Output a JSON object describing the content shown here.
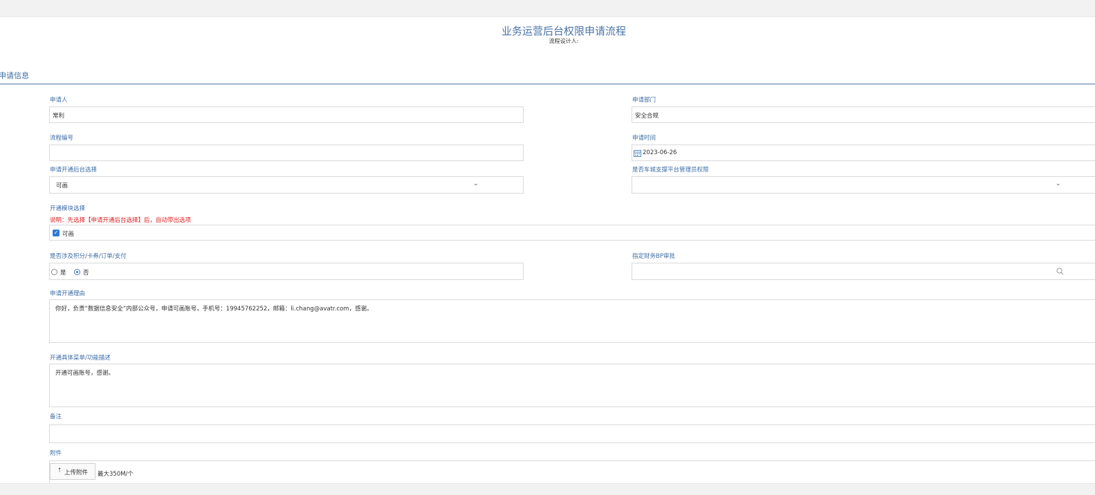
{
  "header": {
    "title": "业务运营后台权限申请流程",
    "designer_label": "流程设计人:"
  },
  "section": {
    "title": "申请信息"
  },
  "form": {
    "applicant": {
      "label": "申请人",
      "value": "常利"
    },
    "department": {
      "label": "申请部门",
      "value": "安全合规"
    },
    "process_no": {
      "label": "流程编号",
      "value": ""
    },
    "apply_time": {
      "label": "申请时间",
      "value": "2023-06-26",
      "icon": "calendar-icon"
    },
    "backend_select": {
      "label": "申请开通后台选择",
      "value": "可画",
      "icon": "chevron-down-icon"
    },
    "admin_permission": {
      "label": "是否车城支撑平台管理员权限",
      "value": "",
      "icon": "chevron-down-icon"
    },
    "module_select": {
      "label": "开通模块选择",
      "note": "说明：先选择【申请开通后台选择】后，自动带出选项",
      "option": {
        "label": "可画",
        "checked": true
      }
    },
    "involves_payment": {
      "label": "是否涉及积分/卡券/订单/支付",
      "options": [
        {
          "label": "是",
          "selected": false
        },
        {
          "label": "否",
          "selected": true
        }
      ]
    },
    "finance_bp": {
      "label": "指定财务BP审批",
      "value": "",
      "icon": "search-icon"
    },
    "reason": {
      "label": "申请开通理由",
      "value": "你好，负责“数据信息安全”内部公众号，申请可画账号，手机号：19945762252，邮箱：li.chang@avatr.com，感谢。"
    },
    "menu_desc": {
      "label": "开通具体菜单/功能描述",
      "value": "开通可画账号，感谢。"
    },
    "remark": {
      "label": "备注",
      "value": ""
    },
    "attachment": {
      "label": "附件",
      "upload_label": "上传附件",
      "upload_icon": "upload-icon",
      "limit": "最大350M/个"
    }
  },
  "colors": {
    "accent": "#3c6da5",
    "note": "#e02020",
    "checkbox": "#2f7cd6"
  }
}
